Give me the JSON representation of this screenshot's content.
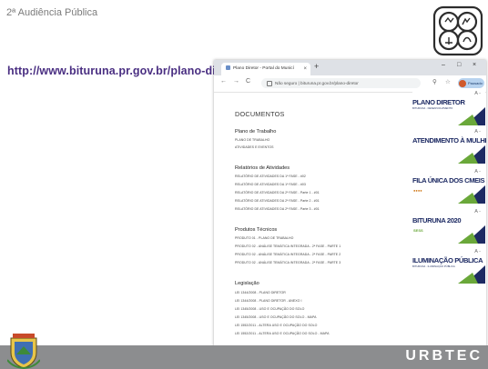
{
  "slide": {
    "title": "2ª Audiência Pública",
    "url": "http://www.bituruna.pr.gov.br/plano-diretor",
    "brand": "URBTEC"
  },
  "colors": {
    "url_purple": "#4a2f82",
    "footer_gray": "#8c8d8f",
    "navy": "#1d2a63",
    "green": "#6aa83a"
  },
  "browser": {
    "tab_title": "Plano Diretor - Portal do Municí",
    "tab_close": "×",
    "new_tab": "+",
    "minimize": "–",
    "maximize": "□",
    "close": "×",
    "back": "←",
    "forward": "→",
    "reload": "C",
    "address": "Não seguro | bituruna.pr.gov.br/plano-diretor",
    "profile_label": "Pausado"
  },
  "page": {
    "heading": "DOCUMENTOS",
    "sections": [
      {
        "title": "Plano de Trabalho",
        "items": [
          "PLANO DE TRABALHO",
          "ATIVIDADES E EVENTOS"
        ]
      },
      {
        "title": "Relatórios de Atividades",
        "items": [
          "RELATÓRIO DE ATIVIDADES DA 1ª FASE - #02",
          "RELATÓRIO DE ATIVIDADES DA 1ª FASE - #03",
          "RELATÓRIO DE ATIVIDADES DA 2ª FASE - Parte 1 - #01",
          "RELATÓRIO DE ATIVIDADES DA 2ª FASE - Parte 2 - #01",
          "RELATÓRIO DE ATIVIDADES DA 2ª FASE - Parte 3 - #01"
        ]
      },
      {
        "title": "Produtos Técnicos",
        "items": [
          "PRODUTO 01 - PLANO DE TRABALHO",
          "PRODUTO 02 - ANÁLISE TEMÁTICA INTEGRADA - 2ª FASE - PARTE 1",
          "PRODUTO 02 - ANÁLISE TEMÁTICA INTEGRADA - 2ª FASE - PARTE 2",
          "PRODUTO 02 - ANÁLISE TEMÁTICA INTEGRADA - 2ª FASE - PARTE 3"
        ]
      },
      {
        "title": "Legislação",
        "items": [
          "LEI 1344/2008 - PLANO DIRETOR",
          "LEI 1344/2008 - PLANO DIRETOR - ANEXO I",
          "LEI 1345/2008 - USO E OCUPAÇÃO DO SOLO",
          "LEI 1345/2008 - USO E OCUPAÇÃO DO SOLO - MAPA",
          "LEI 1552/2011 - ALTERA USO E OCUPAÇÃO DO SOLO",
          "LEI 1552/2011 - ALTERA USO E OCUPAÇÃO DO SOLO - MAPA"
        ]
      }
    ]
  },
  "banners": [
    {
      "head": "A -",
      "title": "PLANO DIRETOR",
      "sub": "BITURUNA · DESENVOLVIMENTO",
      "extra": ""
    },
    {
      "head": "A -",
      "title": "ATENDIMENTO À MULHER",
      "sub": "",
      "extra": ""
    },
    {
      "head": "A -",
      "title": "FILA ÚNICA DOS CMEIS",
      "sub": "",
      "extra": "●●●●"
    },
    {
      "head": "A -",
      "title": "BITURUNA 2020",
      "sub": "",
      "extra": "SESS"
    },
    {
      "head": "A -",
      "title": "ILUMINAÇÃO PÚBLICA",
      "sub": "BITURUNA · ILUMINAÇÃO PÚBLICA",
      "extra": ""
    }
  ]
}
